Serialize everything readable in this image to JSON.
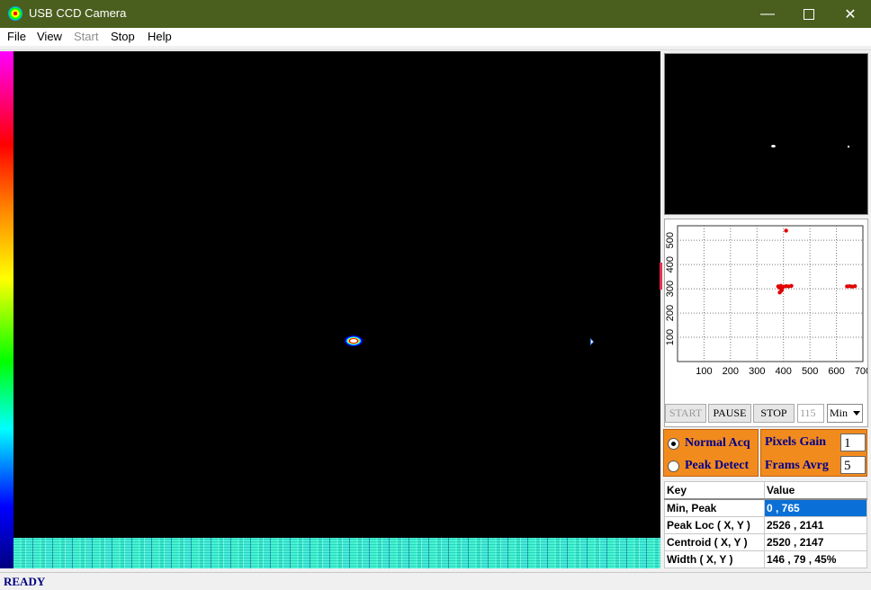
{
  "window": {
    "title": "USB CCD Camera",
    "minimize_icon": "minimize-icon",
    "maximize_icon": "maximize-icon",
    "close_icon": "close-icon"
  },
  "menu": [
    {
      "label": "File",
      "enabled": true
    },
    {
      "label": "View",
      "enabled": true
    },
    {
      "label": "Start",
      "enabled": false
    },
    {
      "label": "Stop",
      "enabled": true
    },
    {
      "label": "Help",
      "enabled": true
    }
  ],
  "plot": {
    "x_ticks": [
      "100",
      "200",
      "300",
      "400",
      "500",
      "600",
      "700"
    ],
    "y_ticks": [
      "100",
      "200",
      "300",
      "400",
      "500"
    ],
    "point_color": "#e00000"
  },
  "chart_data": {
    "type": "scatter",
    "xlim": [
      0,
      700
    ],
    "ylim": [
      0,
      560
    ],
    "grid": true,
    "points": [
      [
        410,
        540
      ],
      [
        380,
        310
      ],
      [
        390,
        312
      ],
      [
        400,
        309
      ],
      [
        410,
        311
      ],
      [
        420,
        310
      ],
      [
        430,
        312
      ],
      [
        385,
        305
      ],
      [
        395,
        300
      ],
      [
        392,
        292
      ],
      [
        386,
        285
      ],
      [
        640,
        310
      ],
      [
        650,
        311
      ],
      [
        660,
        309
      ],
      [
        670,
        311
      ]
    ]
  },
  "controls": {
    "start_label": "START",
    "pause_label": "PAUSE",
    "stop_label": "STOP",
    "count_value": "115",
    "select_value": "Min"
  },
  "mode": {
    "normal_label": "Normal Acq",
    "peak_label": "Peak Detect",
    "selected": "normal"
  },
  "params": {
    "gain_label": "Pixels Gain",
    "gain_value": "1",
    "frames_label": "Frams Avrg",
    "frames_value": "5"
  },
  "table": {
    "headers": [
      "Key",
      "Value"
    ],
    "rows": [
      {
        "key": "Min, Peak",
        "value": "0 , 765"
      },
      {
        "key": "Peak Loc ( X, Y )",
        "value": "2526 , 2141"
      },
      {
        "key": "Centroid ( X, Y )",
        "value": "2520 , 2147"
      },
      {
        "key": "Width ( X, Y )",
        "value": "146 , 79 , 45%"
      }
    ]
  },
  "status": "READY"
}
